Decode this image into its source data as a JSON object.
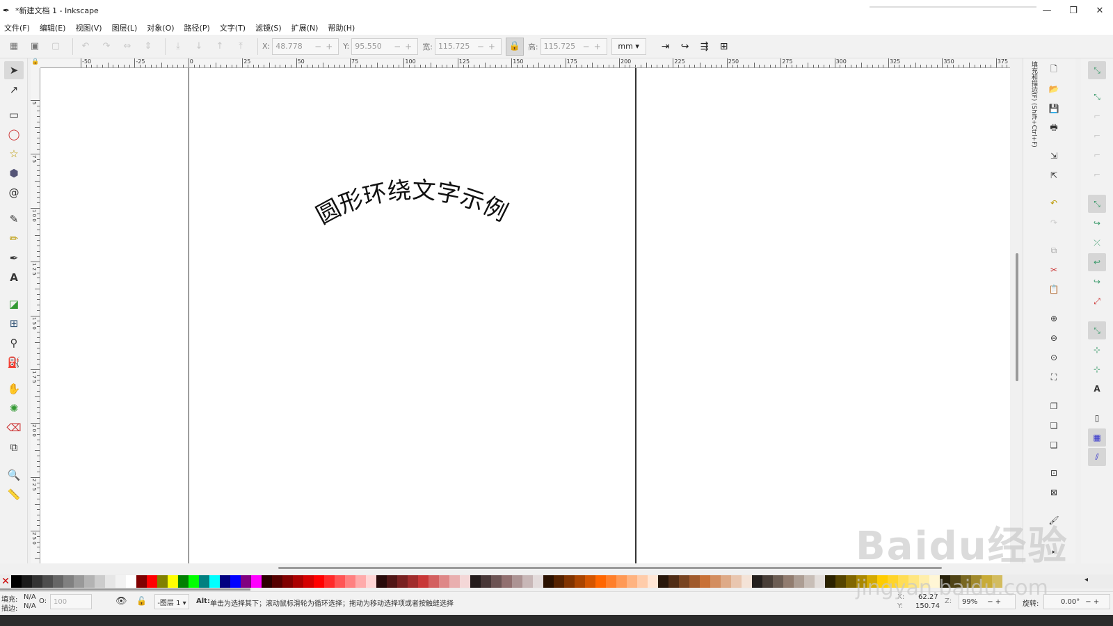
{
  "window": {
    "app_icon": "inkscape-icon",
    "title": "*新建文档 1 - Inkscape",
    "minimize": "—",
    "restore": "❐",
    "close": "✕"
  },
  "menu": [
    "文件(F)",
    "编辑(E)",
    "视图(V)",
    "图层(L)",
    "对象(O)",
    "路径(P)",
    "文字(T)",
    "滤镜(S)",
    "扩展(N)",
    "帮助(H)"
  ],
  "controls": {
    "x_label": "X:",
    "x_value": "48.778",
    "y_label": "Y:",
    "y_value": "95.550",
    "w_label": "宽:",
    "w_value": "115.725",
    "h_label": "高:",
    "h_value": "115.725",
    "unit": "mm ▾"
  },
  "ruler_h_labels": [
    "-50",
    "-25",
    "0",
    "25",
    "50",
    "75",
    "100",
    "125",
    "150",
    "175",
    "200",
    "225",
    "250",
    "275",
    "300",
    "325",
    "350",
    "375"
  ],
  "ruler_v_labels": [
    "5",
    "7 5",
    "1 0 0",
    "1 2 5",
    "1 5 0",
    "1 7 5",
    "2 0 0",
    "2 2 5",
    "2 5 0"
  ],
  "canvas": {
    "curved_text": "圆形环绕文字示例"
  },
  "dock": {
    "tab_label": "填充和描边(F) (Shift+Ctrl+F)"
  },
  "palette_colors": [
    "#000000",
    "#1a1a1a",
    "#333333",
    "#4d4d4d",
    "#666666",
    "#808080",
    "#999999",
    "#b3b3b3",
    "#cccccc",
    "#e6e6e6",
    "#f2f2f2",
    "#ffffff",
    "#800000",
    "#ff0000",
    "#808000",
    "#ffff00",
    "#008000",
    "#00ff00",
    "#008080",
    "#00ffff",
    "#000080",
    "#0000ff",
    "#800080",
    "#ff00ff",
    "#2b0000",
    "#550000",
    "#800000",
    "#aa0000",
    "#d40000",
    "#ff0000",
    "#ff2a2a",
    "#ff5555",
    "#ff8080",
    "#ffaaaa",
    "#ffd5d5",
    "#280b0b",
    "#501616",
    "#782121",
    "#a02c2c",
    "#c83737",
    "#d35f5f",
    "#de8787",
    "#e9afaf",
    "#f4d7d7",
    "#241c1c",
    "#483737",
    "#6c5353",
    "#916f6f",
    "#ac9393",
    "#c8b7b7",
    "#e3dbdb",
    "#2b1100",
    "#552200",
    "#803300",
    "#aa4400",
    "#d45500",
    "#ff6600",
    "#ff7f2a",
    "#ff9955",
    "#ffb380",
    "#ffccaa",
    "#ffe6d5",
    "#28170b",
    "#502d16",
    "#784421",
    "#a05a2c",
    "#c87137",
    "#d38d5f",
    "#deaa87",
    "#e9c6af",
    "#f4e3d7",
    "#241f1c",
    "#483e37",
    "#6c5d53",
    "#917c6f",
    "#ac9d93",
    "#c8beb7",
    "#e3dedb",
    "#2b2200",
    "#554400",
    "#806600",
    "#aa8800",
    "#d4aa00",
    "#ffcc00",
    "#ffd42a",
    "#ffdd55",
    "#ffe680",
    "#ffeeaa",
    "#fff6d5",
    "#28220b",
    "#504416",
    "#786721",
    "#a0892c",
    "#c8ab37",
    "#d3bc5f"
  ],
  "status": {
    "fill_label": "填充:",
    "fill_value": "N/A",
    "stroke_label": "描边:",
    "stroke_value": "N/A",
    "opacity_label": "O:",
    "opacity_value": "100",
    "layer": "-图层 1 ▾",
    "hint_key": "Alt:",
    "hint": "单击为选择其下；滚动鼠标滑轮为循环选择；拖动为移动选择项或者按触缝选择",
    "x_label": "X:",
    "x_value": "62.27",
    "y_label": "Y:",
    "y_value": "150.74",
    "z_label": "Z:",
    "zoom": "99%",
    "rotate_label": "旋转:",
    "rotate": "0.00°"
  },
  "watermark": {
    "logo": "Baidu经验",
    "url": "jingyan.baidu.com"
  }
}
